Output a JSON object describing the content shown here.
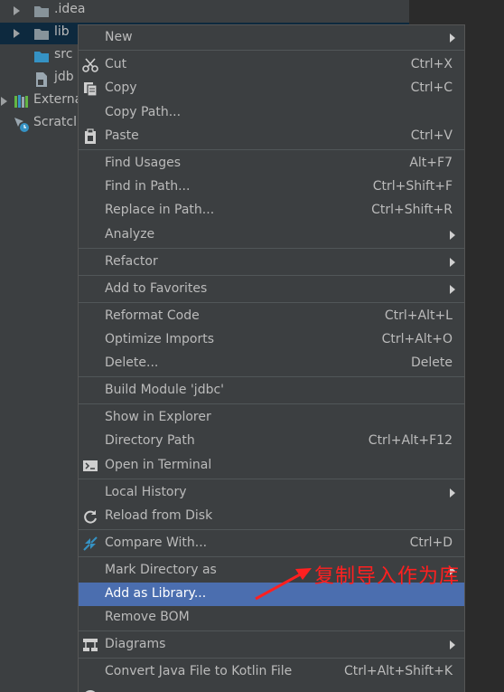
{
  "tree": {
    "items": [
      {
        "label": ".idea",
        "icon": "folder-icon"
      },
      {
        "label": "lib",
        "icon": "folder-icon"
      },
      {
        "label": "src",
        "icon": "source-folder-icon"
      },
      {
        "label": "jdb",
        "icon": "module-file-icon"
      },
      {
        "label": "Externa",
        "icon": "libraries-icon"
      },
      {
        "label": "Scratcl",
        "icon": "scratches-icon"
      }
    ]
  },
  "menu": {
    "items": [
      {
        "label": "New",
        "shortcut": ""
      },
      {
        "label": "Cut",
        "shortcut": "Ctrl+X",
        "icon": "scissors-icon"
      },
      {
        "label": "Copy",
        "shortcut": "Ctrl+C",
        "icon": "copy-icon"
      },
      {
        "label": "Copy Path...",
        "shortcut": ""
      },
      {
        "label": "Paste",
        "shortcut": "Ctrl+V",
        "icon": "paste-icon"
      },
      {
        "label": "Find Usages",
        "shortcut": "Alt+F7"
      },
      {
        "label": "Find in Path...",
        "shortcut": "Ctrl+Shift+F"
      },
      {
        "label": "Replace in Path...",
        "shortcut": "Ctrl+Shift+R"
      },
      {
        "label": "Analyze",
        "shortcut": ""
      },
      {
        "label": "Refactor",
        "shortcut": ""
      },
      {
        "label": "Add to Favorites",
        "shortcut": ""
      },
      {
        "label": "Reformat Code",
        "shortcut": "Ctrl+Alt+L"
      },
      {
        "label": "Optimize Imports",
        "shortcut": "Ctrl+Alt+O"
      },
      {
        "label": "Delete...",
        "shortcut": "Delete"
      },
      {
        "label": "Build Module 'jdbc'",
        "shortcut": ""
      },
      {
        "label": "Show in Explorer",
        "shortcut": ""
      },
      {
        "label": "Directory Path",
        "shortcut": "Ctrl+Alt+F12"
      },
      {
        "label": "Open in Terminal",
        "shortcut": "",
        "icon": "terminal-icon"
      },
      {
        "label": "Local History",
        "shortcut": ""
      },
      {
        "label": "Reload from Disk",
        "shortcut": "",
        "icon": "reload-icon"
      },
      {
        "label": "Compare With...",
        "shortcut": "Ctrl+D",
        "icon": "compare-icon"
      },
      {
        "label": "Mark Directory as",
        "shortcut": ""
      },
      {
        "label": "Add as Library...",
        "shortcut": ""
      },
      {
        "label": "Remove BOM",
        "shortcut": ""
      },
      {
        "label": "Diagrams",
        "shortcut": "",
        "icon": "diagram-icon"
      },
      {
        "label": "Convert Java File to Kotlin File",
        "shortcut": "Ctrl+Alt+Shift+K"
      }
    ]
  },
  "annotation": {
    "text": "复制导入作为库",
    "color": "#ff2020"
  },
  "colors": {
    "highlight": "#4b6eaf",
    "panel": "#3c3f41",
    "text": "#bbbbbb",
    "selected_row": "#0d293e"
  }
}
